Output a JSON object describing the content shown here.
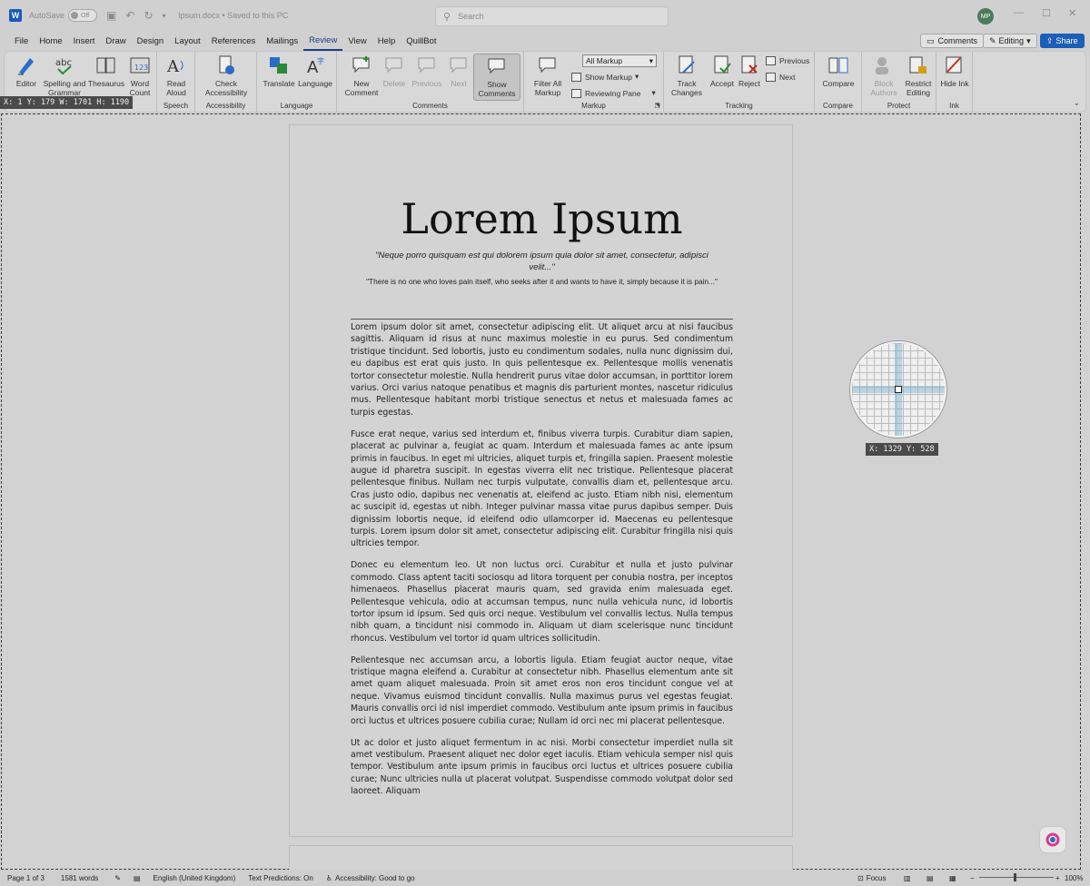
{
  "titlebar": {
    "autosave_label": "AutoSave",
    "autosave_state": "Off",
    "filename": "lpsum.docx • Saved to this PC",
    "search_placeholder": "Search",
    "avatar_initials": "MP"
  },
  "menu": {
    "tabs": [
      "File",
      "Home",
      "Insert",
      "Draw",
      "Design",
      "Layout",
      "References",
      "Mailings",
      "Review",
      "View",
      "Help",
      "QuillBot"
    ],
    "active_tab": "Review",
    "comments_button": "Comments",
    "editing_button": "Editing",
    "share_button": "Share"
  },
  "ribbon": {
    "groups": {
      "proofing": {
        "editor": "Editor",
        "spelling": "Spelling and Grammar",
        "thesaurus": "Thesaurus",
        "word_count": "Word Count"
      },
      "speech": {
        "label": "Speech",
        "read_aloud": "Read Aloud"
      },
      "accessibility": {
        "label": "Accessibility",
        "check": "Check Accessibility"
      },
      "language": {
        "label": "Language",
        "translate": "Translate",
        "language": "Language"
      },
      "comments": {
        "label": "Comments",
        "new": "New Comment",
        "delete": "Delete",
        "previous": "Previous",
        "next": "Next",
        "show": "Show Comments"
      },
      "markup": {
        "label": "Markup",
        "filter_all": "Filter All Markup",
        "all_markup": "All Markup",
        "show_markup": "Show Markup",
        "reviewing_pane": "Reviewing Pane"
      },
      "tracking": {
        "label": "Tracking",
        "track_changes": "Track Changes",
        "accept": "Accept",
        "reject": "Reject",
        "previous": "Previous",
        "next": "Next"
      },
      "compare": {
        "label": "Compare",
        "compare": "Compare"
      },
      "protect": {
        "label": "Protect",
        "block_authors": "Block Authors",
        "restrict_editing": "Restrict Editing"
      },
      "ink": {
        "label": "Ink",
        "hide_ink": "Hide Ink"
      }
    }
  },
  "overlay": {
    "selection_readout": "X: 1 Y: 179 W: 1701 H: 1190",
    "cursor_readout": "X: 1329 Y: 528"
  },
  "document": {
    "title": "Lorem Ipsum",
    "quote_latin": "\"Neque porro quisquam est qui dolorem ipsum quia dolor sit amet, consectetur, adipisci velit...\"",
    "quote_english": "\"There is no one who loves pain itself, who seeks after it and wants to have it, simply because it is pain...\"",
    "paragraphs": [
      "Lorem ipsum dolor sit amet, consectetur adipiscing elit. Ut aliquet arcu at nisi faucibus sagittis. Aliquam id risus at nunc maximus molestie in eu purus. Sed condimentum tristique tincidunt. Sed lobortis, justo eu condimentum sodales, nulla nunc dignissim dui, eu dapibus est erat quis justo. In quis pellentesque ex. Pellentesque mollis venenatis tortor consectetur molestie. Nulla hendrerit purus vitae dolor accumsan, in porttitor lorem varius. Orci varius natoque penatibus et magnis dis parturient montes, nascetur ridiculus mus. Pellentesque habitant morbi tristique senectus et netus et malesuada fames ac turpis egestas.",
      "Fusce erat neque, varius sed interdum et, finibus viverra turpis. Curabitur diam sapien, placerat ac pulvinar a, feugiat ac quam. Interdum et malesuada fames ac ante ipsum primis in faucibus. In eget mi ultricies, aliquet turpis et, fringilla sapien. Praesent molestie augue id pharetra suscipit. In egestas viverra elit nec tristique. Pellentesque placerat pellentesque finibus. Nullam nec turpis vulputate, convallis diam et, pellentesque arcu. Cras justo odio, dapibus nec venenatis at, eleifend ac justo. Etiam nibh nisi, elementum ac suscipit id, egestas ut nibh. Integer pulvinar massa vitae purus dapibus semper. Duis dignissim lobortis neque, id eleifend odio ullamcorper id. Maecenas eu pellentesque turpis. Lorem ipsum dolor sit amet, consectetur adipiscing elit. Curabitur fringilla nisi quis ultricies tempor.",
      "Donec eu elementum leo. Ut non luctus orci. Curabitur et nulla et justo pulvinar commodo. Class aptent taciti sociosqu ad litora torquent per conubia nostra, per inceptos himenaeos. Phasellus placerat mauris quam, sed gravida enim malesuada eget. Pellentesque vehicula, odio at accumsan tempus, nunc nulla vehicula nunc, id lobortis tortor ipsum id ipsum. Sed quis orci neque. Vestibulum vel convallis lectus. Nulla tempus nibh quam, a tincidunt nisi commodo in. Aliquam ut diam scelerisque nunc tincidunt rhoncus. Vestibulum vel tortor id quam ultrices sollicitudin.",
      "Pellentesque nec accumsan arcu, a lobortis ligula. Etiam feugiat auctor neque, vitae tristique magna eleifend a. Curabitur at consectetur nibh. Phasellus elementum ante sit amet quam aliquet malesuada. Proin sit amet eros non eros tincidunt congue vel at neque. Vivamus euismod tincidunt convallis. Nulla maximus purus vel egestas feugiat. Mauris convallis orci id nisl imperdiet commodo. Vestibulum ante ipsum primis in faucibus orci luctus et ultrices posuere cubilia curae; Nullam id orci nec mi placerat pellentesque.",
      "Ut ac dolor et justo aliquet fermentum in ac nisi. Morbi consectetur imperdiet nulla sit amet vestibulum. Praesent aliquet nec dolor eget iaculis. Etiam vehicula semper nisl quis tempor. Vestibulum ante ipsum primis in faucibus orci luctus et ultrices posuere cubilia curae; Nunc ultricies nulla ut placerat volutpat. Suspendisse commodo volutpat dolor sed laoreet. Aliquam"
    ]
  },
  "statusbar": {
    "page": "Page 1 of 3",
    "words": "1581 words",
    "language": "English (United Kingdom)",
    "text_predictions": "Text Predictions: On",
    "accessibility": "Accessibility: Good to go",
    "focus": "Focus",
    "zoom": "100%"
  },
  "colors": {
    "accent": "#1b5fb8",
    "active_tab": "#1b3f8a"
  }
}
